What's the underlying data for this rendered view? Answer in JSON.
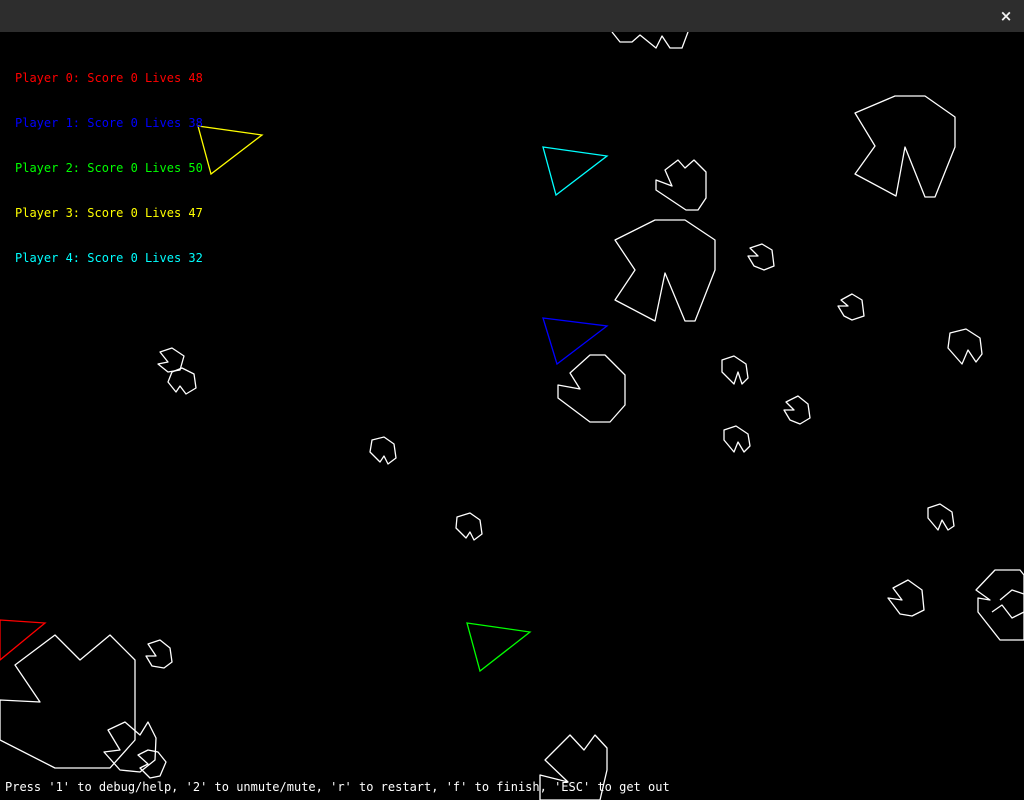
{
  "titlebar": {
    "close_glyph": "×"
  },
  "hud": {
    "players": [
      {
        "label": "Player 0: Score 0 Lives 48",
        "color": "#ff0000"
      },
      {
        "label": "Player 1: Score 0 Lives 38",
        "color": "#0000ff"
      },
      {
        "label": "Player 2: Score 0 Lives 50",
        "color": "#00ff00"
      },
      {
        "label": "Player 3: Score 0 Lives 47",
        "color": "#ffff00"
      },
      {
        "label": "Player 4: Score 0 Lives 32",
        "color": "#00ffff"
      }
    ]
  },
  "footer": {
    "help_text": "Press '1' to debug/help, '2' to unmute/mute, 'r' to restart, 'f' to finish, 'ESC' to get out"
  },
  "colors": {
    "asteroid": "#ffffff",
    "background": "#000000",
    "titlebar": "#2d2d2d"
  }
}
